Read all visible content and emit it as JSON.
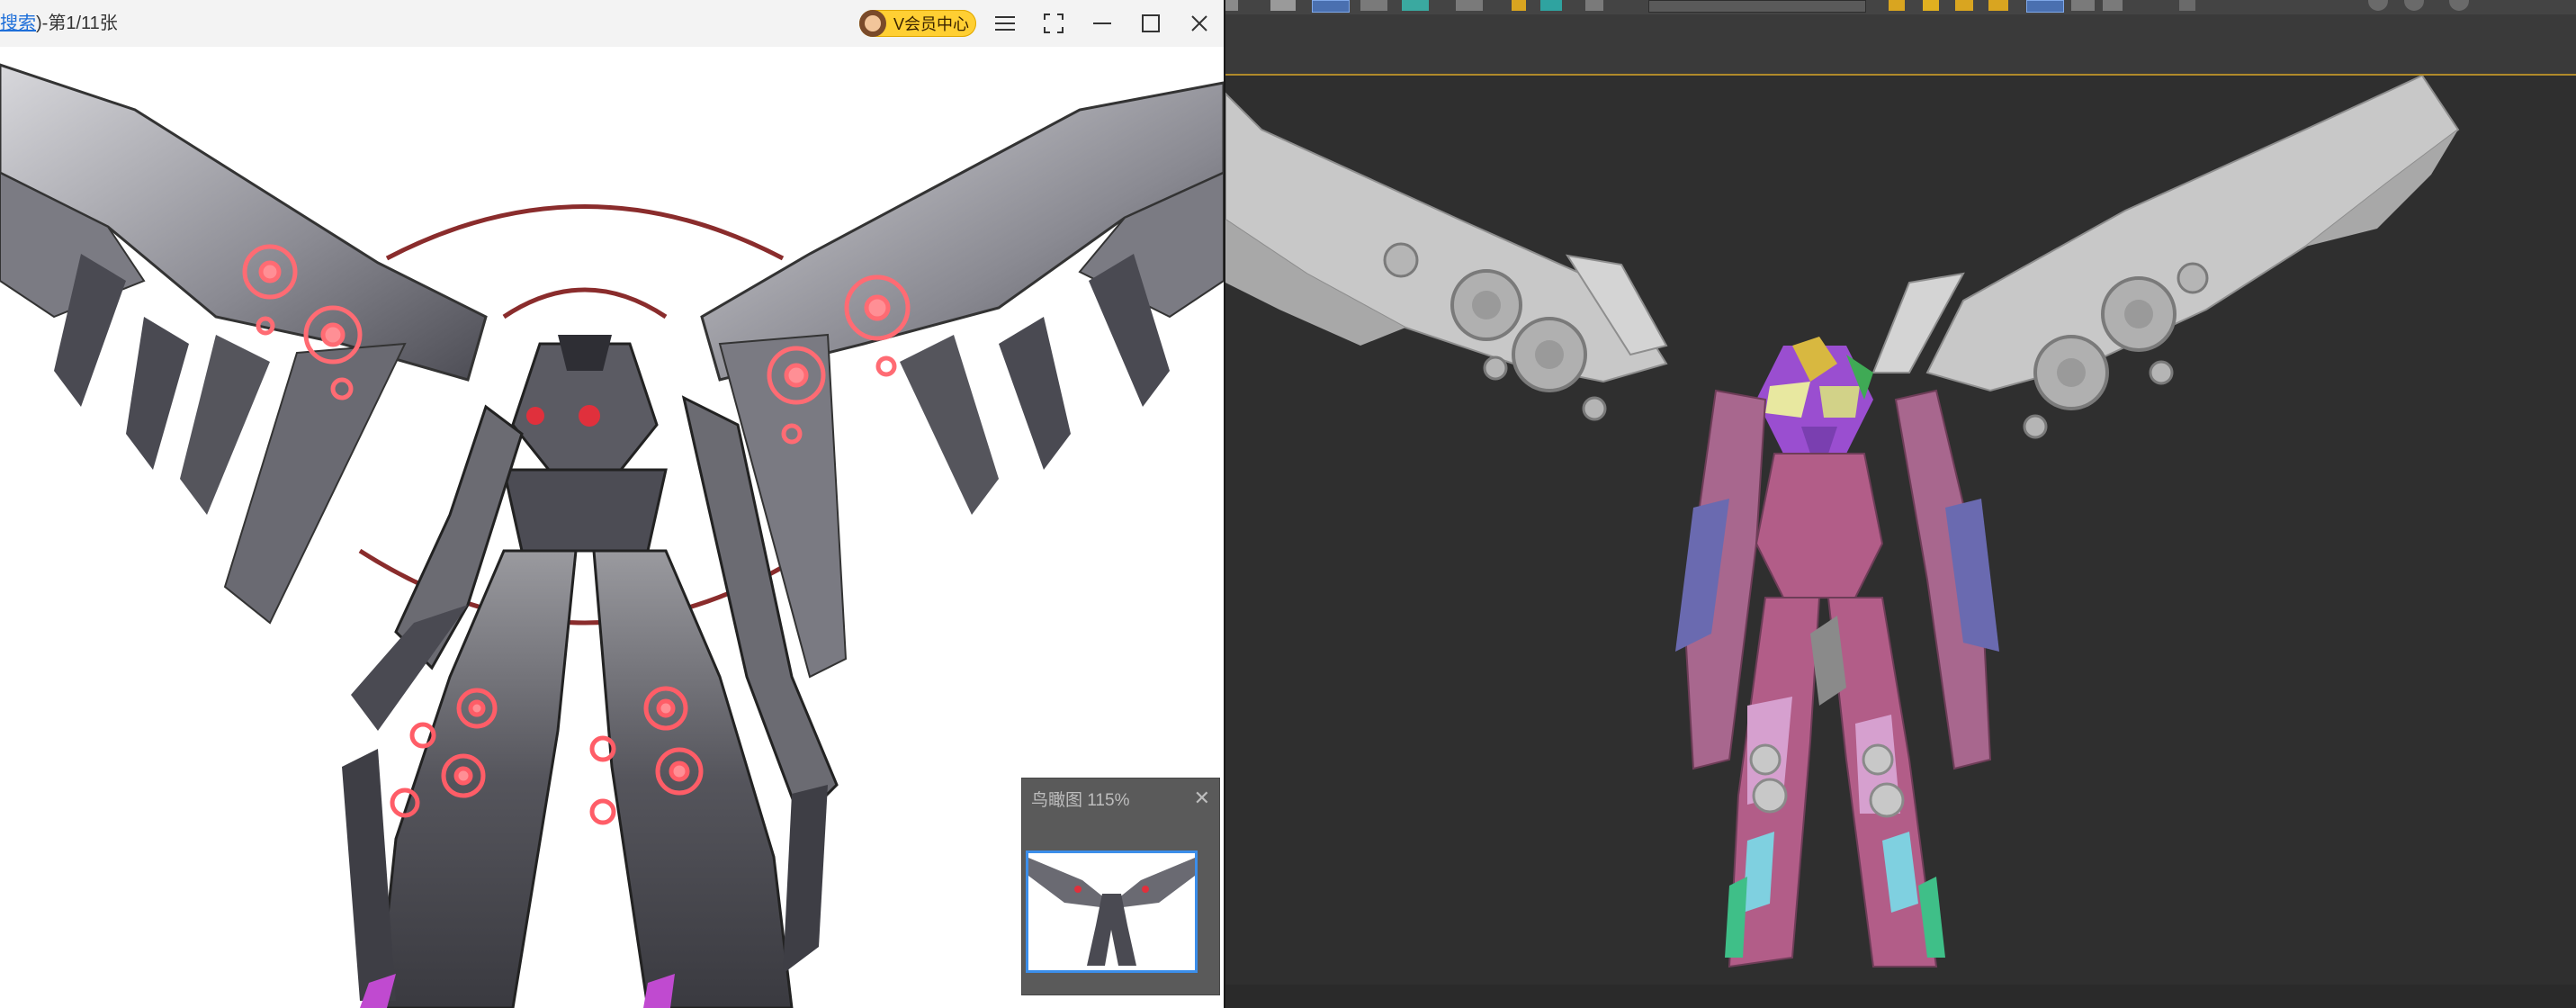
{
  "viewer": {
    "title_link": "搜索",
    "title_counter": ")-第1/11张",
    "vip_label": "V会员中心",
    "menu_icon": "hamburger-menu-icon",
    "navigator": {
      "title": "鸟瞰图 115%",
      "zoom_percent": 115
    }
  },
  "colors": {
    "accent_blue": "#1e6fd9",
    "vip_yellow": "#ffcf33",
    "viewport_frame": "#b08a2a",
    "viewport_bg": "#2f2f2f",
    "mech_pink": "#b8557a",
    "mech_grey": "#cfcfcf",
    "glow_red": "#e0303c"
  }
}
